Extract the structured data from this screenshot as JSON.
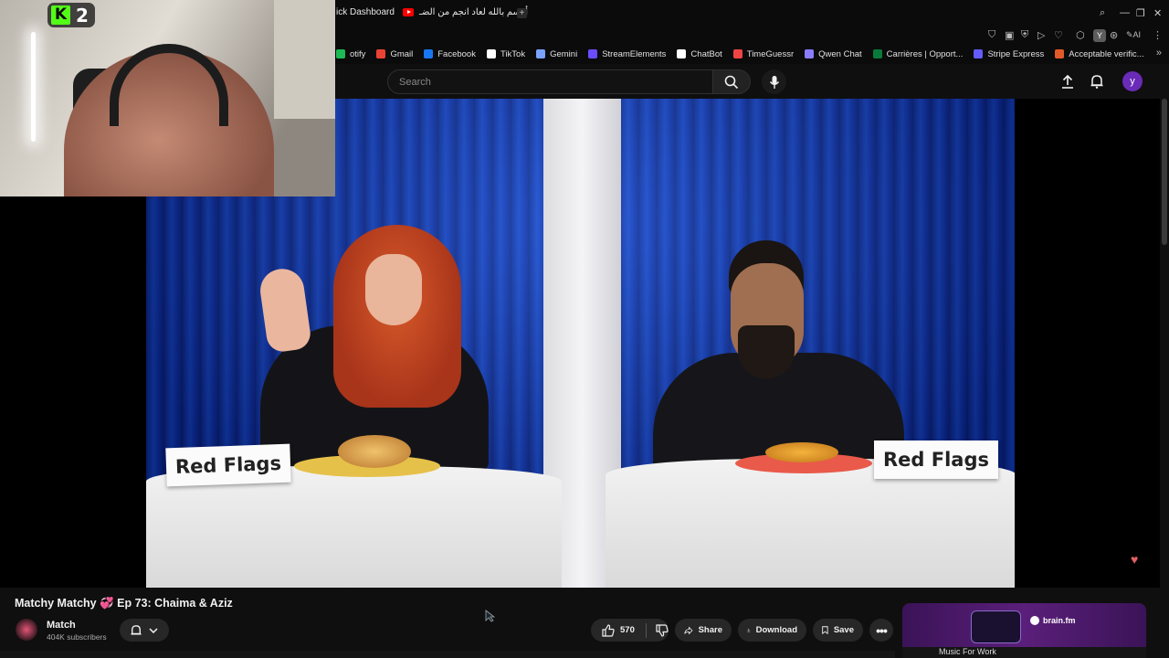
{
  "browser": {
    "tabs": [
      {
        "label": "ick Dashboard"
      },
      {
        "label": "أقسم بالله لعاد انجم من الضـ"
      }
    ],
    "new_tab": "+",
    "address_ai": "AI",
    "profile_letter": "Y"
  },
  "bookmarks": [
    {
      "label": "otify",
      "color": "#1db954"
    },
    {
      "label": "Gmail",
      "color": "#ea4335"
    },
    {
      "label": "Facebook",
      "color": "#1877f2"
    },
    {
      "label": "TikTok",
      "color": "#ffffff"
    },
    {
      "label": "Gemini",
      "color": "#7aa2ff"
    },
    {
      "label": "StreamElements",
      "color": "#6b4cff"
    },
    {
      "label": "ChatBot",
      "color": "#ffffff"
    },
    {
      "label": "TimeGuessr",
      "color": "#e44"
    },
    {
      "label": "Qwen Chat",
      "color": "#8a7cff"
    },
    {
      "label": "Carrières | Opport...",
      "color": "#0a7a3a"
    },
    {
      "label": "Stripe Express",
      "color": "#635bff"
    },
    {
      "label": "Acceptable verific...",
      "color": "#e25a2a"
    }
  ],
  "masthead": {
    "search_placeholder": "Search",
    "avatar_letter": "y"
  },
  "video": {
    "signs": [
      "Red Flags",
      "Red Flags"
    ]
  },
  "overlay": {
    "kick_letter": "K",
    "viewer_count": "2"
  },
  "info": {
    "title_prefix": "Matchy Matchy",
    "title_emoji": "💞",
    "title_suffix": "Ep 73: Chaima & Aziz",
    "channel_name": "Match",
    "subscribers": "404K subscribers",
    "likes": "570",
    "share_label": "Share",
    "download_label": "Download",
    "save_label": "Save"
  },
  "ad": {
    "brand": "brain.fm",
    "bottom_text": "Music For Work"
  },
  "colors": {
    "kick_green": "#53fc18",
    "yt_red": "#ff0000",
    "avatar_purple": "#6a2bb8"
  }
}
